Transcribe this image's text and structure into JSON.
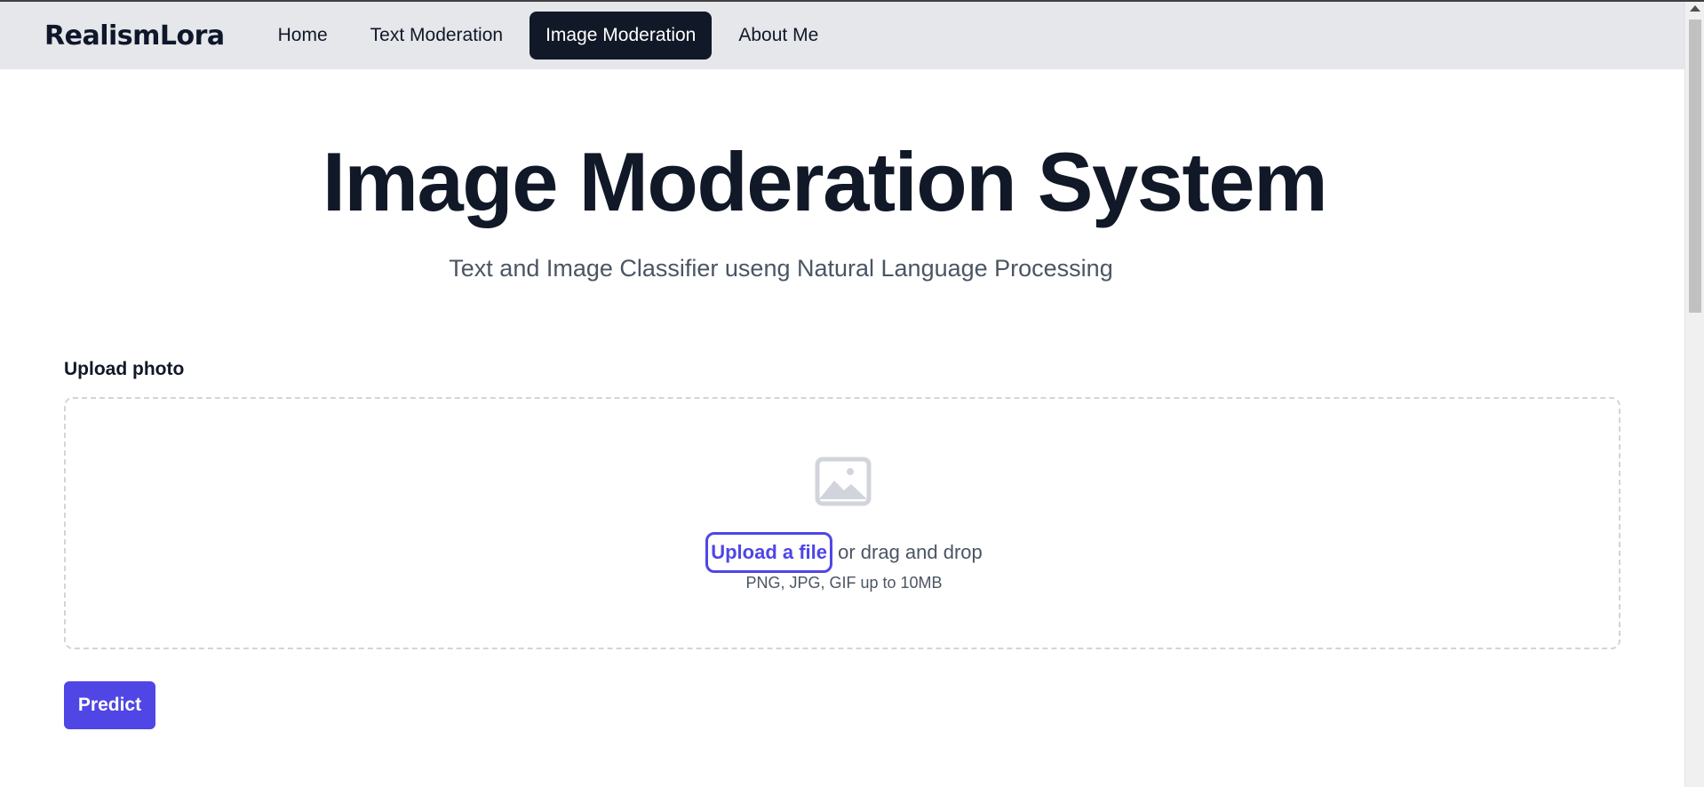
{
  "navbar": {
    "brand": "RealismLora",
    "links": [
      {
        "label": "Home"
      },
      {
        "label": "Text Moderation"
      },
      {
        "label": "Image Moderation",
        "active": true
      },
      {
        "label": "About Me"
      }
    ]
  },
  "hero": {
    "title": "Image Moderation System",
    "subtitle": "Text and Image Classifier useng Natural Language Processing"
  },
  "upload": {
    "label": "Upload photo",
    "icon": "photo-icon",
    "link_text": "Upload a file",
    "drag_text": " or drag and drop",
    "hint": "PNG, JPG, GIF up to 10MB"
  },
  "actions": {
    "predict_label": "Predict"
  },
  "colors": {
    "navbar_bg": "#e5e7eb",
    "active_nav_bg": "#111827",
    "accent": "#4f46e5",
    "title_text": "#111827",
    "muted_text": "#4b5563"
  }
}
